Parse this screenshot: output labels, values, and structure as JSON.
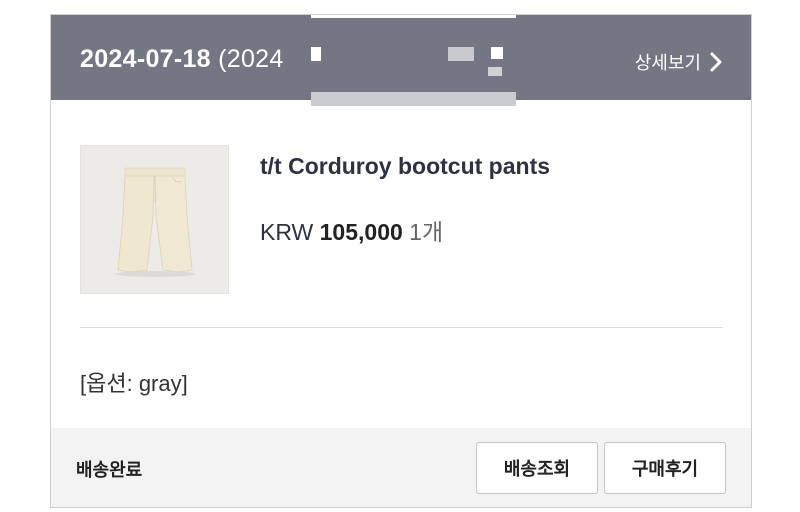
{
  "header": {
    "order_date": "2024-07-18",
    "order_date_extra": " (2024",
    "detail_label": "상세보기",
    "detail_icon": "chevron-right-icon",
    "background_color": "#737683"
  },
  "product": {
    "name": "t/t Corduroy bootcut pants",
    "currency": "KRW",
    "price": "105,000",
    "quantity": "1개",
    "thumbnail_icon": "pants-image"
  },
  "option": {
    "text": "[옵션: gray]"
  },
  "footer": {
    "status": "배송완료",
    "track_button_label": "배송조회",
    "review_button_label": "구매후기"
  }
}
